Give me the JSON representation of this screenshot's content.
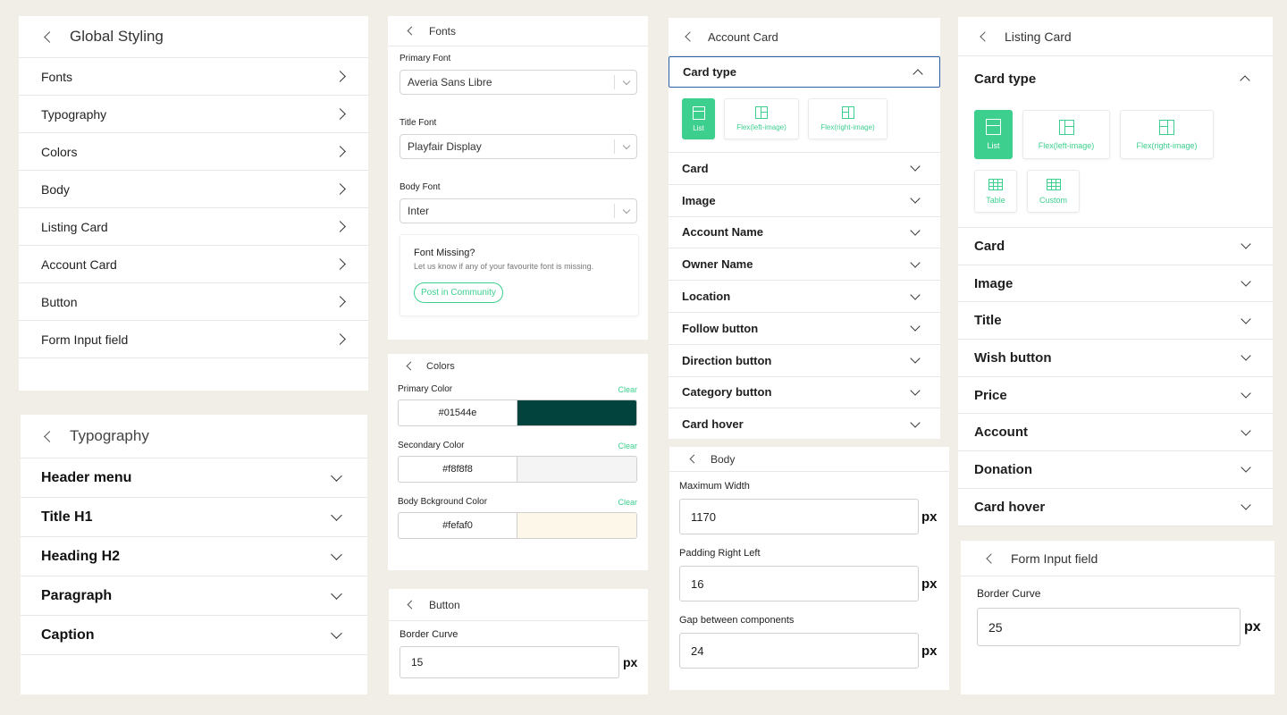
{
  "global_styling": {
    "title": "Global Styling",
    "items": [
      "Fonts",
      "Typography",
      "Colors",
      "Body",
      "Listing Card",
      "Account Card",
      "Button",
      "Form Input field"
    ]
  },
  "typography": {
    "title": "Typography",
    "items": [
      "Header menu",
      "Title H1",
      "Heading H2",
      "Paragraph",
      "Caption"
    ]
  },
  "fonts": {
    "title": "Fonts",
    "fields": [
      {
        "label": "Primary Font",
        "value": "Averia Sans Libre"
      },
      {
        "label": "Title Font",
        "value": "Playfair Display"
      },
      {
        "label": "Body Font",
        "value": "Inter"
      }
    ],
    "missing_title": "Font Missing?",
    "missing_text": "Let us know if any of your favourite font is missing.",
    "post_button": "Post in Community"
  },
  "colors": {
    "title": "Colors",
    "clear_label": "Clear",
    "fields": [
      {
        "label": "Primary Color",
        "value": "#01544e",
        "swatch": "#02443d"
      },
      {
        "label": "Secondary Color",
        "value": "#f8f8f8",
        "swatch": "#f4f4f4"
      },
      {
        "label": "Body Bckground Color",
        "value": "#fefaf0",
        "swatch": "#fdf7ea"
      }
    ]
  },
  "button_panel": {
    "title": "Button",
    "label": "Border Curve",
    "value": "15",
    "unit": "px"
  },
  "account_card": {
    "title": "Account Card",
    "card_type_label": "Card type",
    "tiles": [
      "List",
      "Flex(left-image)",
      "Flex(right-image)"
    ],
    "sections": [
      "Card",
      "Image",
      "Account Name",
      "Owner Name",
      "Location",
      "Follow button",
      "Direction button",
      "Category button",
      "Card hover"
    ]
  },
  "body_panel": {
    "title": "Body",
    "fields": [
      {
        "label": "Maximum Width",
        "value": "1170"
      },
      {
        "label": "Padding Right Left",
        "value": "16"
      },
      {
        "label": "Gap between components",
        "value": "24"
      }
    ],
    "unit": "px"
  },
  "listing_card": {
    "title": "Listing Card",
    "card_type_label": "Card type",
    "tiles": [
      "List",
      "Flex(left-image)",
      "Flex(right-image)",
      "Table",
      "Custom"
    ],
    "sections": [
      "Card",
      "Image",
      "Title",
      "Wish button",
      "Price",
      "Account",
      "Donation",
      "Card hover"
    ]
  },
  "form_input": {
    "title": "Form Input field",
    "label": "Border Curve",
    "value": "25",
    "unit": "px"
  },
  "accent_color": "#3ccf8e",
  "background_color": "#f1ede7"
}
